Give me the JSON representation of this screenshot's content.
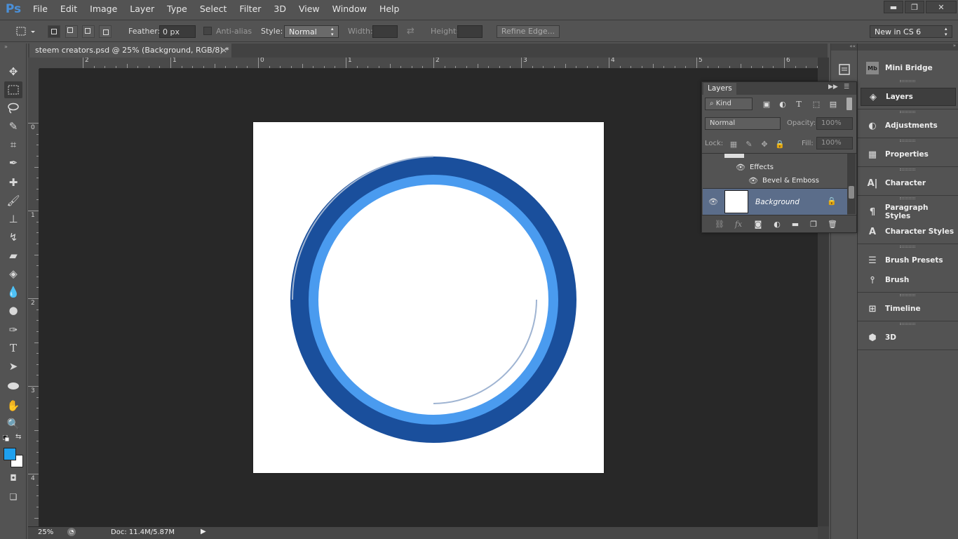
{
  "app": {
    "logo": "Ps"
  },
  "menu": [
    "File",
    "Edit",
    "Image",
    "Layer",
    "Type",
    "Select",
    "Filter",
    "3D",
    "View",
    "Window",
    "Help"
  ],
  "window_controls": {
    "minimize": "▬",
    "restore": "❐",
    "close": "✕"
  },
  "options": {
    "feather_label": "Feather:",
    "feather_value": "0 px",
    "antialias_label": "Anti-alias",
    "style_label": "Style:",
    "style_value": "Normal",
    "width_label": "Width:",
    "height_label": "Height:",
    "refine_label": "Refine Edge...",
    "workspace_value": "New in CS 6"
  },
  "document": {
    "tab_title": "steem creators.psd @ 25% (Background, RGB/8) *",
    "close": "×",
    "zoom": "25%",
    "doc_size": "Doc: 11.4M/5.87M"
  },
  "ruler": {
    "h_labels": [
      "2",
      "1",
      "0",
      "1",
      "2",
      "3",
      "4",
      "5",
      "6"
    ],
    "v_labels": [
      "0",
      "1",
      "2",
      "3",
      "4"
    ]
  },
  "artwork": {
    "outer_ring_color": "#1a4f9c",
    "inner_stripe_color": "#4a9bef",
    "background_color": "#ffffff"
  },
  "colors": {
    "foreground": "#1ea0ee",
    "background": "#ffffff"
  },
  "layers_panel": {
    "tab": "Layers",
    "filter_kind": "Kind",
    "blend_mode": "Normal",
    "opacity_label": "Opacity:",
    "opacity_value": "100%",
    "lock_label": "Lock:",
    "fill_label": "Fill:",
    "fill_value": "100%",
    "effects_label": "Effects",
    "effect_item": "Bevel & Emboss",
    "background_layer": "Background"
  },
  "collapsed_panels": [
    "Mini Bridge",
    "Layers",
    "Adjustments",
    "Properties",
    "Character",
    "Paragraph Styles",
    "Character Styles",
    "Brush Presets",
    "Brush",
    "Timeline",
    "3D"
  ]
}
